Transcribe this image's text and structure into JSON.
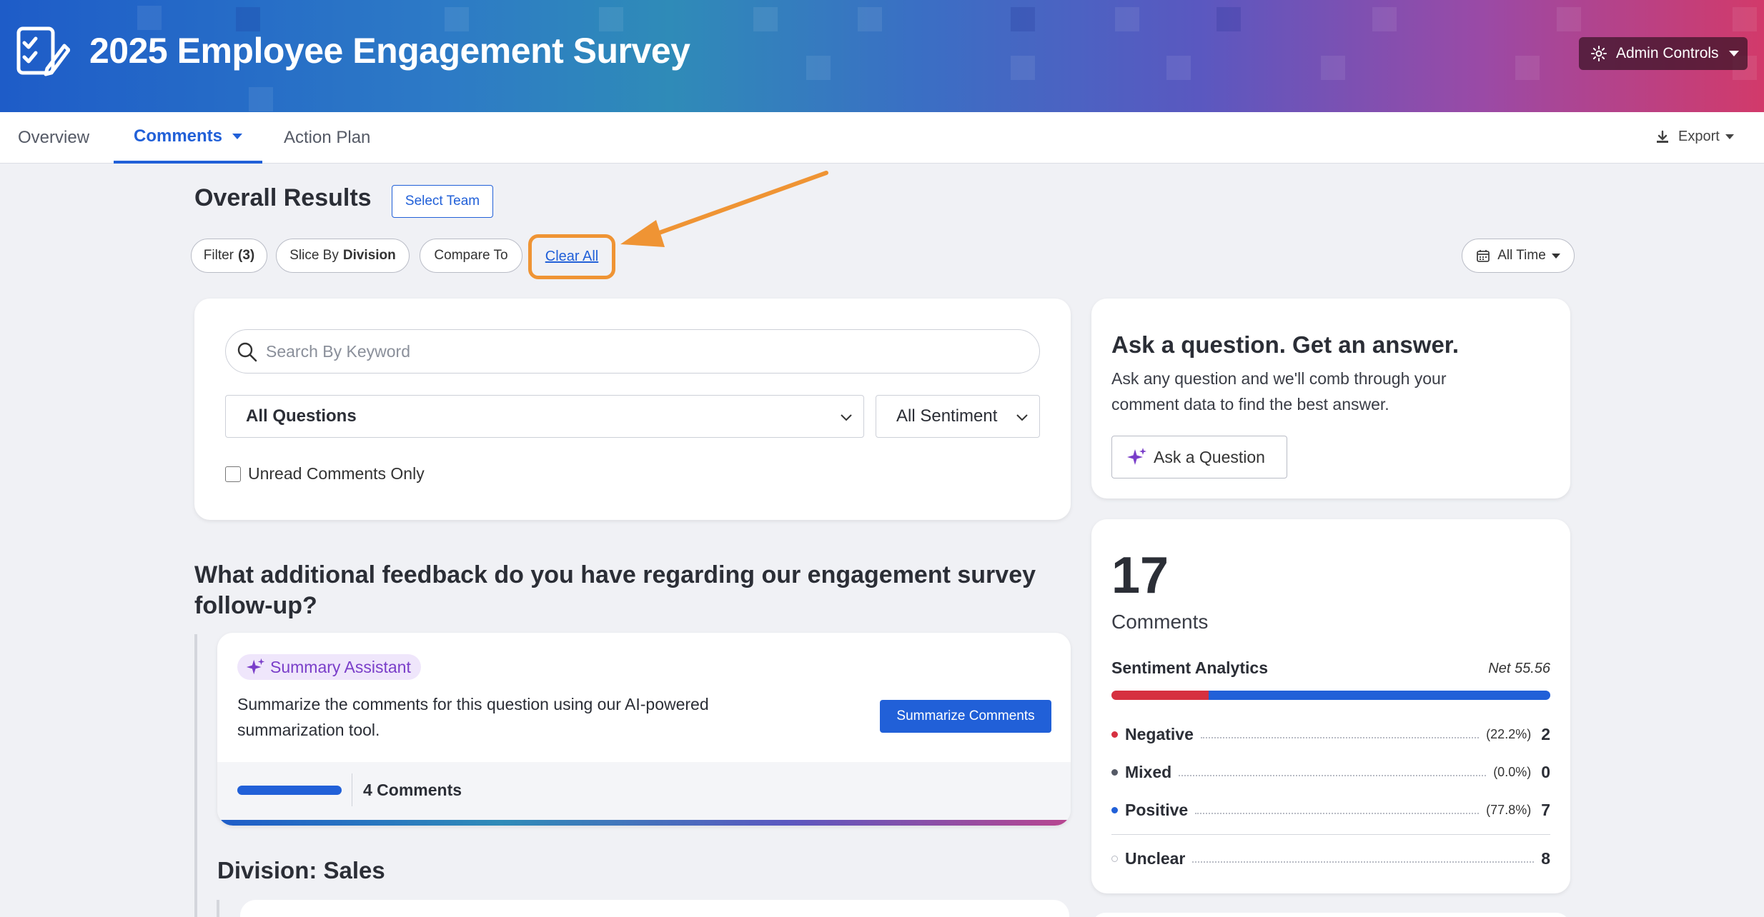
{
  "header": {
    "title": "2025 Employee Engagement Survey",
    "admin_label": "Admin Controls",
    "logo_icon": "survey-checklist-icon"
  },
  "tabs": [
    {
      "label": "Overview"
    },
    {
      "label": "Comments",
      "active": true
    },
    {
      "label": "Action Plan"
    }
  ],
  "export_label": "Export",
  "results": {
    "title": "Overall Results",
    "select_team": "Select Team",
    "filter_label": "Filter",
    "filter_count": "(3)",
    "slice_label": "Slice By",
    "slice_value": "Division",
    "compare_label": "Compare To",
    "clear_all": "Clear All",
    "time_range": "All Time"
  },
  "search": {
    "placeholder": "Search By Keyword",
    "questions_select": "All Questions",
    "sentiment_select": "All Sentiment",
    "unread_label": "Unread Comments Only"
  },
  "ask": {
    "title": "Ask a question. Get an answer.",
    "description": "Ask any question and we'll comb through your comment data to find the best answer.",
    "button": "Ask a Question"
  },
  "stats": {
    "count": "17",
    "count_label": "Comments",
    "analytics_title": "Sentiment Analytics",
    "net": "Net 55.56",
    "bar": [
      {
        "name": "negative",
        "fraction": 0.222,
        "color": "#d63040"
      },
      {
        "name": "positive",
        "fraction": 0.778,
        "color": "#2160d8"
      }
    ],
    "rows": [
      {
        "label": "Negative",
        "pct": "(22.2%)",
        "count": "2",
        "color": "#d63040"
      },
      {
        "label": "Mixed",
        "pct": "(0.0%)",
        "count": "0",
        "color": "#555a66"
      },
      {
        "label": "Positive",
        "pct": "(77.8%)",
        "count": "7",
        "color": "#2160d8"
      },
      {
        "label": "Unclear",
        "pct": "",
        "count": "8",
        "color": "#ffffff"
      }
    ]
  },
  "question": {
    "text": "What additional feedback do you have regarding our engagement survey follow-up?",
    "assistant_label": "Summary Assistant",
    "assistant_desc": "Summarize the comments for this question using our AI-powered summarization tool.",
    "summarize_button": "Summarize Comments",
    "comments_count": "4 Comments",
    "division_heading": "Division: Sales"
  },
  "colors": {
    "accent": "#2160d8",
    "highlight": "#ef9434",
    "assistant": "#7a3ec9"
  }
}
